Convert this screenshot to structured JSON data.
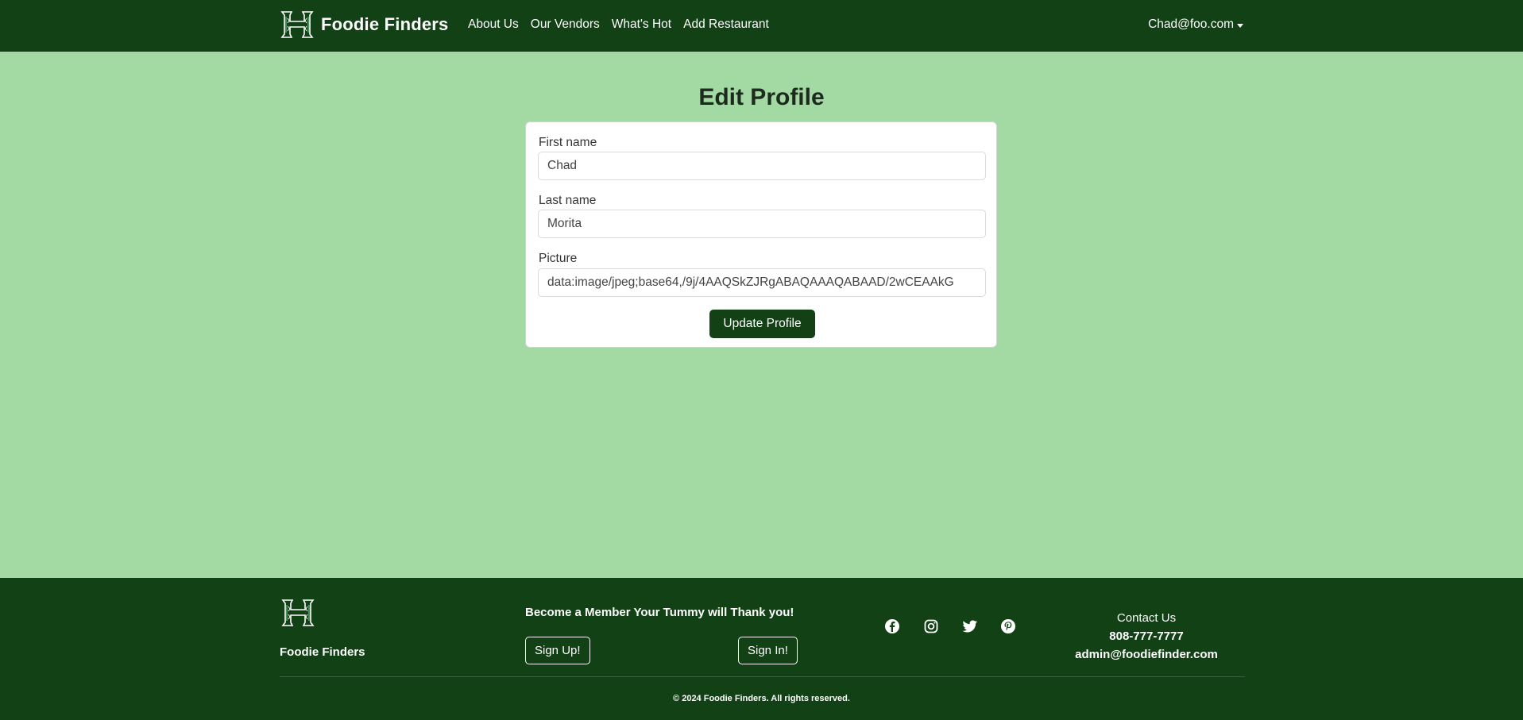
{
  "nav": {
    "brand": "Foodie Finders",
    "links": [
      "About Us",
      "Our Vendors",
      "What's Hot",
      "Add Restaurant"
    ],
    "user": "Chad@foo.com"
  },
  "page": {
    "title": "Edit Profile"
  },
  "form": {
    "first_name_label": "First name",
    "first_name_value": "Chad",
    "last_name_label": "Last name",
    "last_name_value": "Morita",
    "picture_label": "Picture",
    "picture_value": "data:image/jpeg;base64,/9j/4AAQSkZJRgABAQAAAQABAAD/2wCEAAkG",
    "submit_label": "Update Profile"
  },
  "footer": {
    "brand": "Foodie Finders",
    "tagline": "Become a Member Your Tummy will Thank you!",
    "signup_label": "Sign Up!",
    "signin_label": "Sign In!",
    "social_icons": [
      "facebook-icon",
      "instagram-icon",
      "twitter-icon",
      "pinterest-icon"
    ],
    "contact_title": "Contact Us",
    "phone": "808-777-7777",
    "email": "admin@foodiefinder.com",
    "copyright": "© 2024 Foodie Finders. All rights reserved."
  },
  "colors": {
    "primary": "#124116",
    "background": "#a3d9a3",
    "card": "#ffffff"
  }
}
